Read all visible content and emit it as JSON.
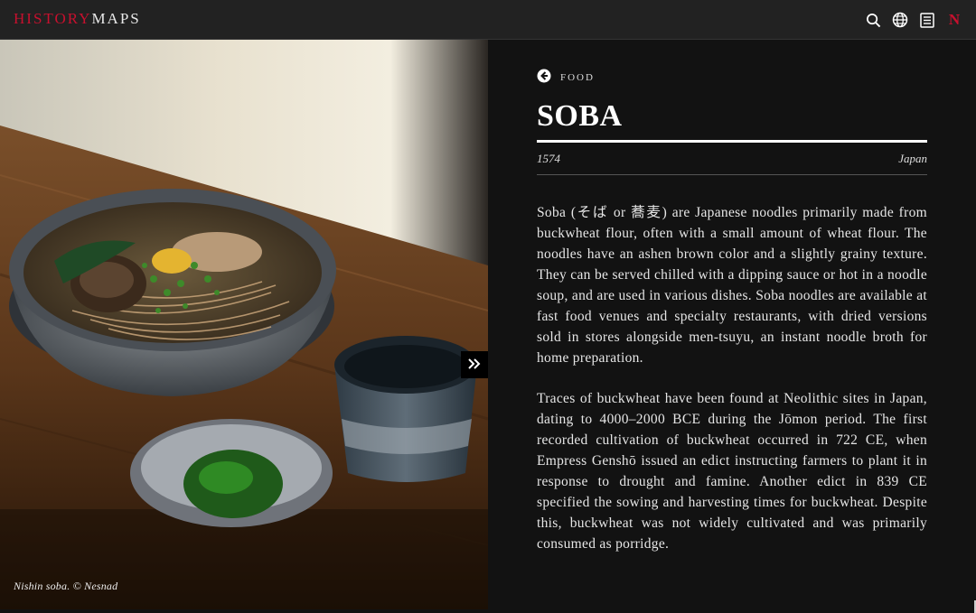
{
  "header": {
    "logo_part1": "HISTORY",
    "logo_part2": "MAPS",
    "n_label": "N"
  },
  "image": {
    "caption": "Nishin soba. © Nesnad"
  },
  "article": {
    "category": "FOOD",
    "title": "SOBA",
    "year": "1574",
    "region": "Japan",
    "paragraphs": [
      "Soba (そば or 蕎麦) are Japanese noodles primarily made from buckwheat flour, often with a small amount of wheat flour. The noodles have an ashen brown color and a slightly grainy texture. They can be served chilled with a dipping sauce or hot in a noodle soup, and are used in various dishes. Soba noodles are available at fast food venues and specialty restaurants, with dried versions sold in stores alongside men-tsuyu, an instant noodle broth for home preparation.",
      "Traces of buckwheat have been found at Neolithic sites in Japan, dating to 4000–2000 BCE during the Jōmon period. The first recorded cultivation of buckwheat occurred in 722 CE, when Empress Genshō issued an edict instructing farmers to plant it in response to drought and famine. Another edict in 839 CE specified the sowing and harvesting times for buckwheat. Despite this, buckwheat was not widely cultivated and was primarily consumed as porridge."
    ]
  },
  "colors": {
    "brand_red": "#c8102e",
    "header_bg": "#222222",
    "panel_bg": "#121212"
  }
}
